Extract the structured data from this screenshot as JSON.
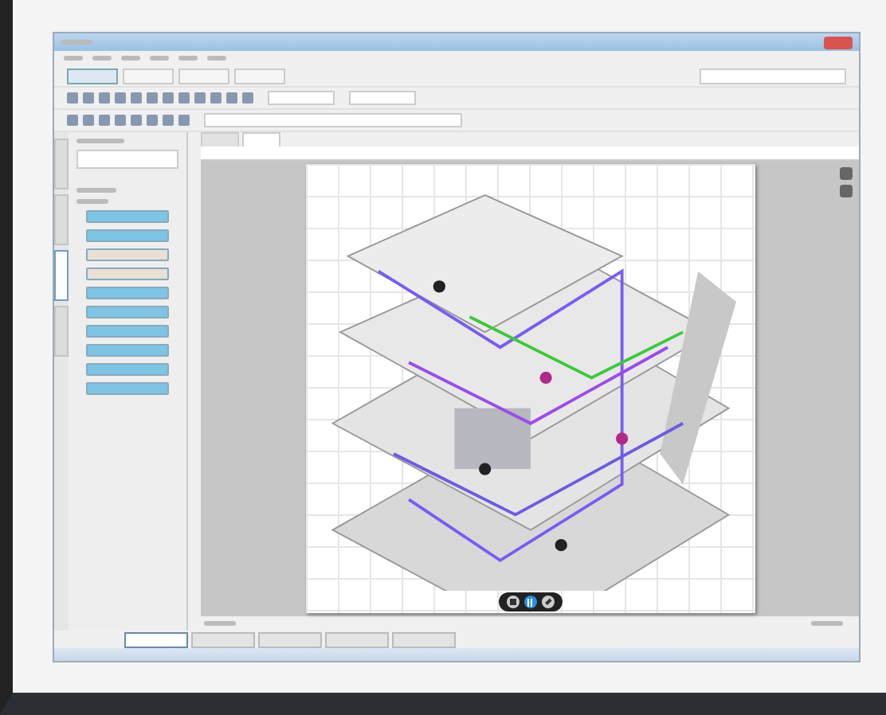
{
  "window": {
    "kind": "app"
  },
  "menu": [
    {
      "kind": "entry"
    },
    {
      "kind": "entry"
    },
    {
      "kind": "entry"
    },
    {
      "kind": "entry"
    },
    {
      "kind": "entry"
    },
    {
      "kind": "entry"
    }
  ],
  "mode_buttons": [
    {
      "selected": true
    },
    {
      "selected": false
    },
    {
      "selected": false
    },
    {
      "selected": false
    }
  ],
  "side_tabs": [
    {
      "selected": false
    },
    {
      "selected": false
    },
    {
      "selected": true
    },
    {
      "selected": false
    }
  ],
  "side_buttons": [
    {
      "color": "#7fc4e4"
    },
    {
      "color": "#7fc4e4"
    },
    {
      "color": "#e8e0d4"
    },
    {
      "color": "#e8e0d4"
    },
    {
      "color": "#7fc4e4"
    },
    {
      "color": "#7fc4e4"
    },
    {
      "color": "#7fc4e4"
    },
    {
      "color": "#7fc4e4"
    },
    {
      "color": "#7fc4e4"
    },
    {
      "color": "#7fc4e4"
    }
  ],
  "doc_tabs": [
    {
      "selected": false
    },
    {
      "selected": true
    }
  ],
  "player": [
    {
      "kind": "stop",
      "selected": false
    },
    {
      "kind": "pause",
      "selected": true
    },
    {
      "kind": "expand",
      "selected": false
    }
  ],
  "bottom_tabs": [
    {
      "selected": true
    },
    {
      "selected": false
    },
    {
      "selected": false
    },
    {
      "selected": false
    },
    {
      "selected": false
    }
  ]
}
